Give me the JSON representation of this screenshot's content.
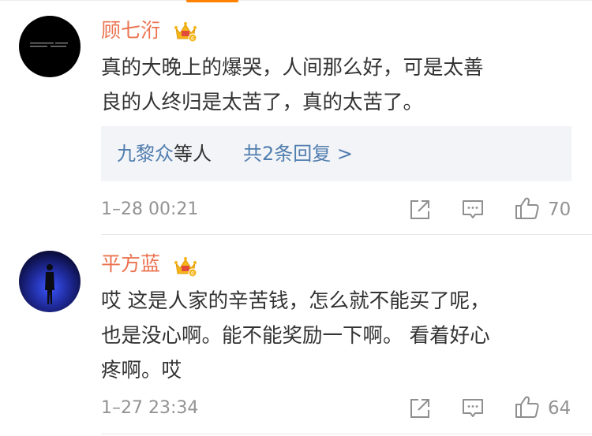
{
  "comments": [
    {
      "username": "顾七洐",
      "avatar_text": "",
      "text": "真的大晚上的爆哭，人间那么好，可是太善\n良的人终归是太苦了，真的太苦了。",
      "replies": {
        "names": "九黎众",
        "names_suffix": "等人",
        "more": "共2条回复 >"
      },
      "time": "1–28 00:21",
      "likes": "70"
    },
    {
      "username": "平方蓝",
      "text": "哎 这是人家的辛苦钱，怎么就不能买了呢，\n也是没心啊。能不能奖励一下啊。 看着好心\n疼啊。哎",
      "time": "1–27 23:34",
      "likes": "64"
    }
  ],
  "icons": {
    "share": "share-icon",
    "comment": "comment-icon",
    "like": "thumbs-up-icon",
    "badge": "vip-crown-badge-icon"
  },
  "colors": {
    "username": "#eb7350",
    "link": "#507daf",
    "meta": "#939393",
    "reply_bg": "#f2f4f7",
    "badge": "#f5b61a"
  }
}
